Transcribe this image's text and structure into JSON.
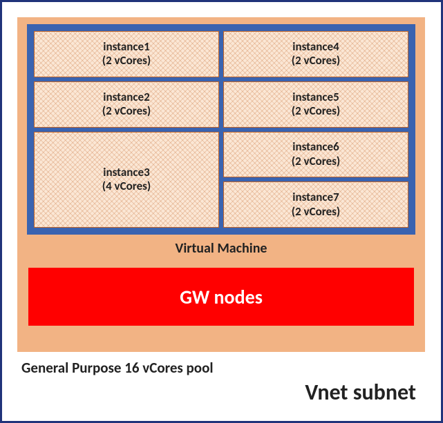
{
  "subnet_label": "Vnet subnet",
  "pool_label": "General Purpose 16 vCores pool",
  "vm_label": "Virtual Machine",
  "gw_label": "GW nodes",
  "instances": {
    "i1": {
      "name": "instance1",
      "cores": "(2 vCores)"
    },
    "i2": {
      "name": "instance2",
      "cores": "(2 vCores)"
    },
    "i3": {
      "name": "instance3",
      "cores": "(4 vCores)"
    },
    "i4": {
      "name": "instance4",
      "cores": "(2 vCores)"
    },
    "i5": {
      "name": "instance5",
      "cores": "(2 vCores)"
    },
    "i6": {
      "name": "instance6",
      "cores": "(2 vCores)"
    },
    "i7": {
      "name": "instance7",
      "cores": "(2 vCores)"
    }
  }
}
